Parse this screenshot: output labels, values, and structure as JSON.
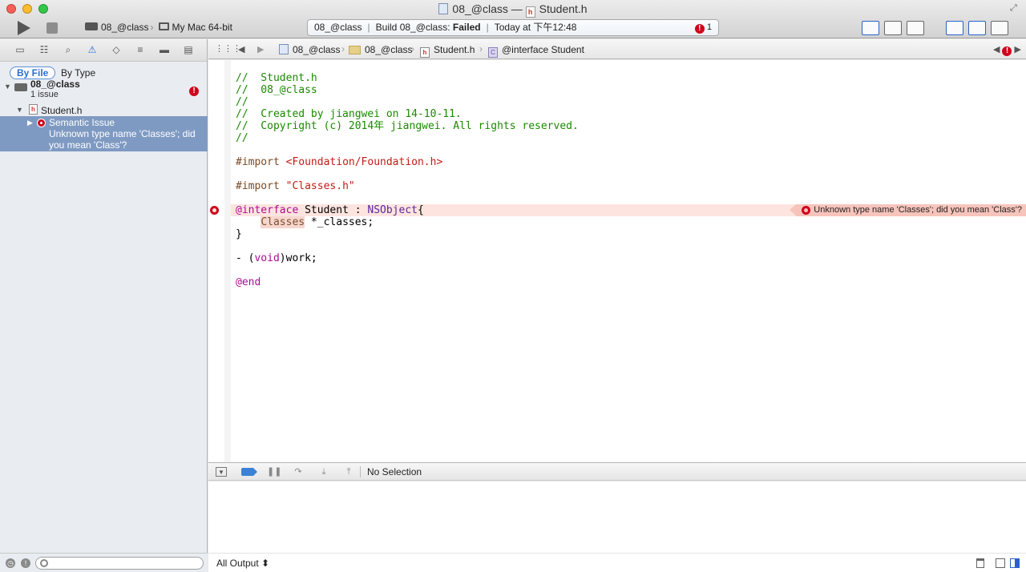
{
  "window": {
    "title_project": "08_@class",
    "title_sep": "—",
    "title_file": "Student.h"
  },
  "toolbar": {
    "scheme": "08_@class",
    "destination": "My Mac 64-bit",
    "activity": {
      "project": "08_@class",
      "build_prefix": "Build 08_@class:",
      "build_status": "Failed",
      "time": "Today at 下午12:48",
      "error_count": "1"
    }
  },
  "navigator": {
    "segments": {
      "by_file": "By File",
      "by_type": "By Type"
    },
    "project": {
      "name": "08_@class",
      "issues": "1 issue"
    },
    "file": {
      "name": "Student.h"
    },
    "issue": {
      "title": "Semantic Issue",
      "message": "Unknown type name 'Classes'; did you mean 'Class'?"
    }
  },
  "jumpbar": {
    "crumbs": [
      "08_@class",
      "08_@class",
      "Student.h",
      "@interface Student"
    ]
  },
  "editor": {
    "lines": {
      "l1": "//  Student.h",
      "l2": "//  08_@class",
      "l3": "//",
      "l4": "//  Created by jiangwei on 14-10-11.",
      "l5": "//  Copyright (c) 2014年 jiangwei. All rights reserved.",
      "l6": "//",
      "l8a": "#import ",
      "l8b": "<Foundation/Foundation.h>",
      "l10a": "#import ",
      "l10b": "\"Classes.h\"",
      "l12a": "@interface",
      "l12b": " Student : ",
      "l12c": "NSObject",
      "l12d": "{",
      "l13a": "    ",
      "l13b": "Classes",
      "l13c": " *_classes;",
      "l14": "}",
      "l16a": "- (",
      "l16b": "void",
      "l16c": ")work;",
      "l18": "@end"
    },
    "inline_error": "Unknown type name 'Classes'; did you mean 'Class'?"
  },
  "debug": {
    "no_selection": "No Selection",
    "output_filter": "All Output ⬍"
  },
  "colors": {
    "error": "#d0021b",
    "comment": "#1a8a00",
    "keyword": "#aa0d91",
    "string": "#c41a16",
    "selection": "#7f9ac2"
  }
}
